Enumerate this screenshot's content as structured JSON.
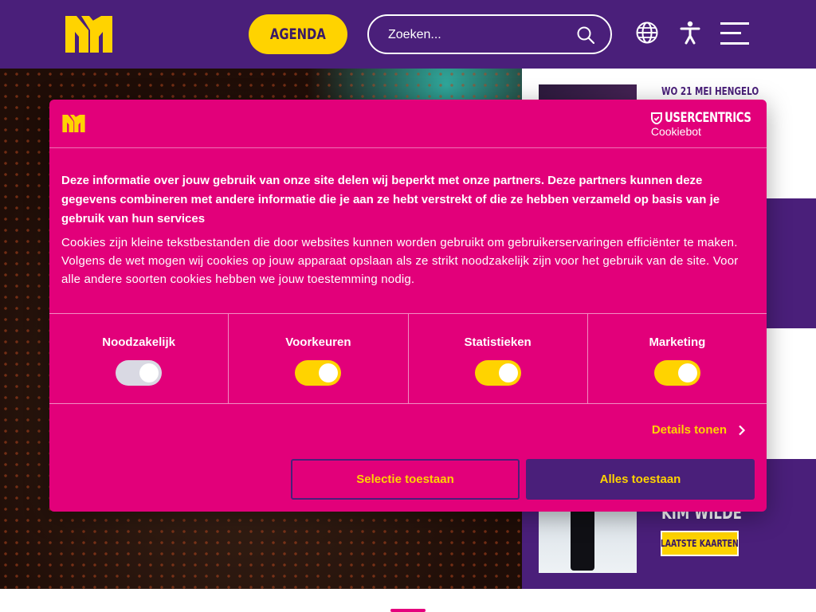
{
  "header": {
    "agenda_label": "AGENDA",
    "search_placeholder": "Zoeken..."
  },
  "sidebar": {
    "events": [
      {
        "date": "WO 21 MEI HENGELO"
      },
      {
        "name": "KIM WILDE",
        "badge": "LAATSTE KAARTEN"
      }
    ]
  },
  "cookie_dialog": {
    "brand_name": "USERCENTRICS",
    "brand_sub": "Cookiebot",
    "lead": "Deze informatie over jouw gebruik van onze site delen wij beperkt met onze partners. Deze partners kunnen deze gegevens combineren met andere informatie die je aan ze hebt verstrekt of die ze hebben verzameld op basis van je gebruik van hun services",
    "description": "Cookies zijn kleine tekstbestanden die door websites kunnen worden gebruikt om gebruikerservaringen efficiënter te maken. Volgens de wet mogen wij cookies op jouw apparaat opslaan als ze strikt noodzakelijk zijn voor het gebruik van de site. Voor alle andere soorten cookies hebben we jouw toestemming nodig.",
    "categories": [
      {
        "label": "Noodzakelijk",
        "enabled": true,
        "locked": true
      },
      {
        "label": "Voorkeuren",
        "enabled": true
      },
      {
        "label": "Statistieken",
        "enabled": true
      },
      {
        "label": "Marketing",
        "enabled": true
      }
    ],
    "details_label": "Details tonen",
    "allow_selection_label": "Selectie toestaan",
    "allow_all_label": "Alles toestaan"
  },
  "colors": {
    "header_purple": "#4a1f7a",
    "accent_yellow": "#ffd300",
    "dialog_magenta": "#e2007a"
  }
}
